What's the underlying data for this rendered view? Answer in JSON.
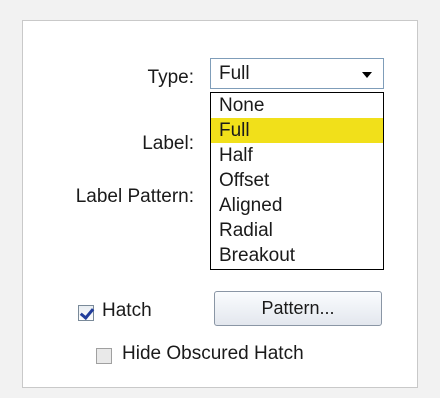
{
  "type_field": {
    "label": "Type:",
    "value": "Full",
    "options": [
      "None",
      "Full",
      "Half",
      "Offset",
      "Aligned",
      "Radial",
      "Breakout"
    ],
    "selected_index": 1
  },
  "label_field": {
    "label": "Label:"
  },
  "label_pattern_field": {
    "label": "Label Pattern:"
  },
  "hatch": {
    "label": "Hatch",
    "checked": true
  },
  "pattern_button": {
    "label": "Pattern..."
  },
  "hide_obscured_hatch": {
    "label": "Hide Obscured Hatch",
    "checked": false
  },
  "colors": {
    "highlight": "#f1e01a",
    "check": "#213d9b"
  }
}
